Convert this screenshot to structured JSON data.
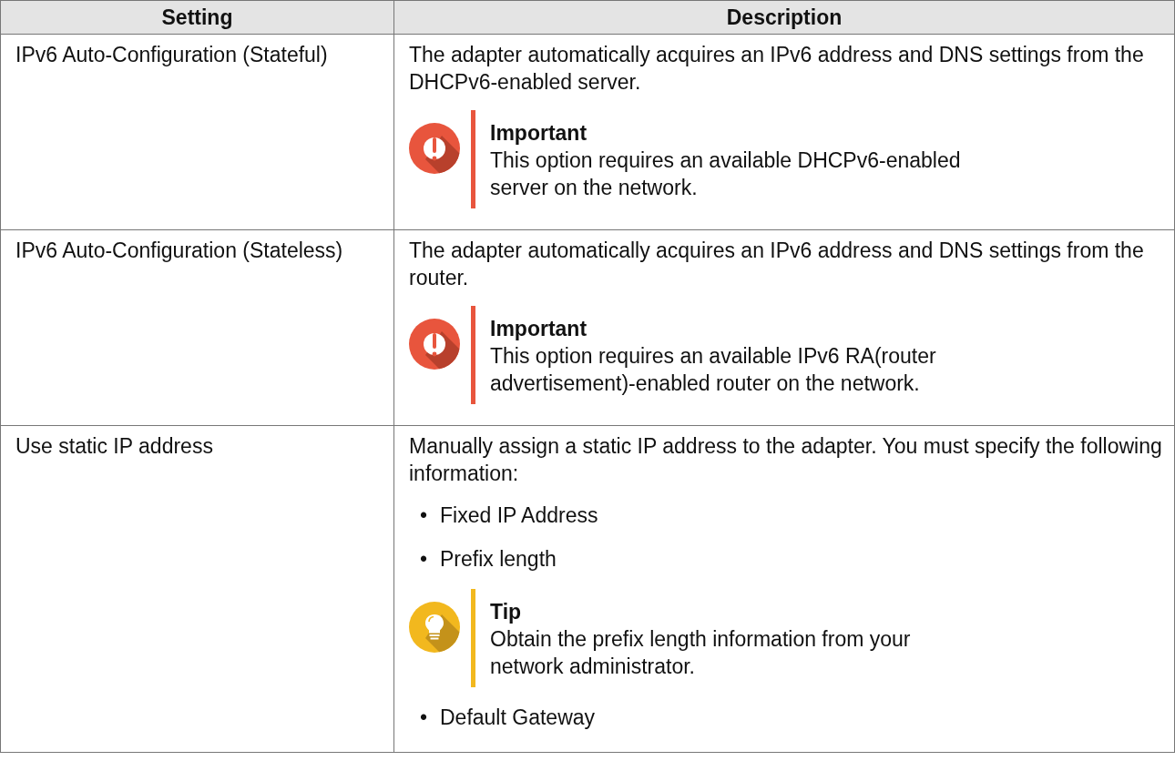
{
  "table": {
    "columns": [
      "Setting",
      "Description"
    ],
    "rows": [
      {
        "setting": "IPv6 Auto-Configuration (Stateful)",
        "description": [
          {
            "kind": "paragraph",
            "text": "The adapter automatically acquires an IPv6 address and DNS settings from the DHCPv6-enabled server."
          },
          {
            "kind": "important",
            "title": "Important",
            "lines": [
              "This option requires an available DHCPv6-enabled",
              "server on the network."
            ]
          }
        ]
      },
      {
        "setting": "IPv6 Auto-Configuration (Stateless)",
        "description": [
          {
            "kind": "paragraph",
            "text": "The adapter automatically acquires an IPv6 address and DNS settings from the router."
          },
          {
            "kind": "important",
            "title": "Important",
            "lines": [
              "This option requires an available IPv6 RA(router",
              "advertisement)-enabled router on the network."
            ]
          }
        ]
      },
      {
        "setting": "Use static IP address",
        "description": [
          {
            "kind": "paragraph",
            "text": "Manually assign a static IP address to the adapter. You must specify the following information:"
          },
          {
            "kind": "bullet",
            "marker": "•",
            "text": "Fixed IP Address"
          },
          {
            "kind": "bullet",
            "marker": "•",
            "text": "Prefix length"
          },
          {
            "kind": "tip",
            "title": "Tip",
            "lines": [
              "Obtain the prefix length information from your",
              "network administrator."
            ]
          },
          {
            "kind": "bullet",
            "marker": "•",
            "text": "Default Gateway"
          }
        ]
      }
    ]
  }
}
